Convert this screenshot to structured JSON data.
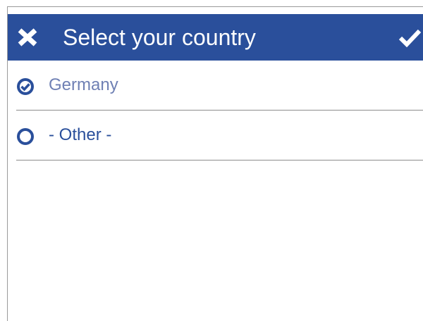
{
  "header": {
    "title": "Select your country",
    "close_icon": "close-icon",
    "confirm_icon": "checkmark-icon",
    "background_color": "#2a4f9b"
  },
  "options": [
    {
      "label": "Germany",
      "selected": true,
      "icon": "radio-checked-icon"
    },
    {
      "label": "- Other -",
      "selected": false,
      "icon": "radio-empty-icon"
    }
  ],
  "colors": {
    "accent": "#2a4f9b",
    "selected_text": "#6f80b4",
    "divider": "#8c8c8c"
  }
}
